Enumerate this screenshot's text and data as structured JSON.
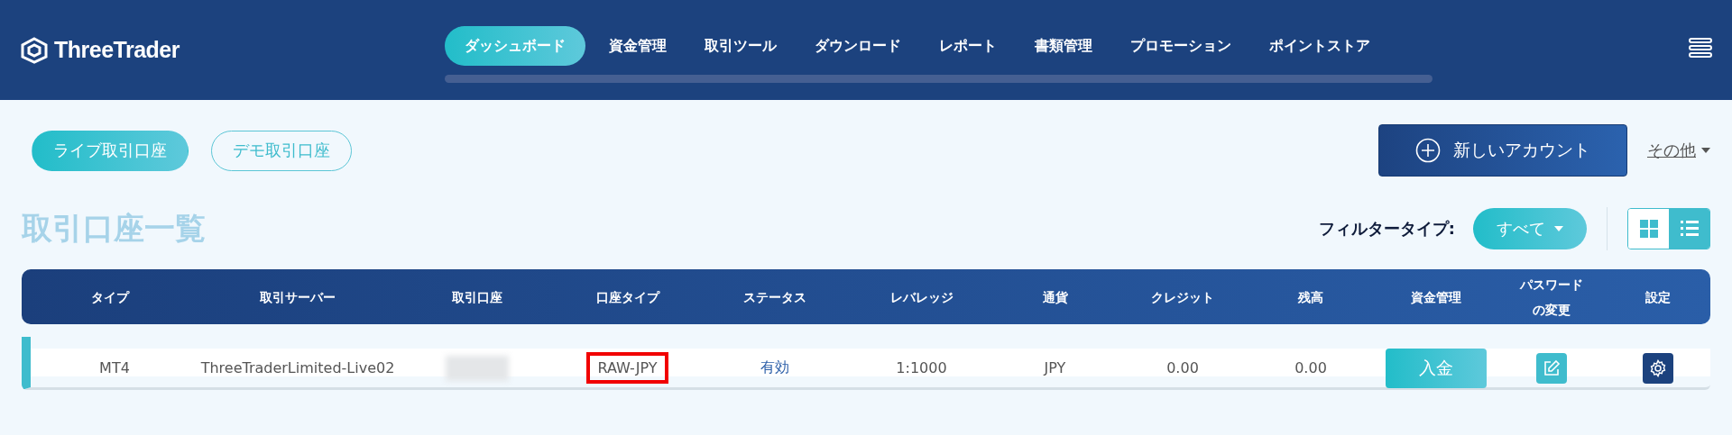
{
  "header": {
    "logo": "ThreeTrader",
    "nav": [
      {
        "label": "ダッシュボード",
        "selected": true
      },
      {
        "label": "資金管理",
        "selected": false
      },
      {
        "label": "取引ツール",
        "selected": false
      },
      {
        "label": "ダウンロード",
        "selected": false
      },
      {
        "label": "レポート",
        "selected": false
      },
      {
        "label": "書類管理",
        "selected": false
      },
      {
        "label": "プロモーション",
        "selected": false
      },
      {
        "label": "ポイントストア",
        "selected": false
      }
    ]
  },
  "account_tabs": [
    {
      "label": "ライブ取引口座",
      "selected": true
    },
    {
      "label": "デモ取引口座",
      "selected": false
    }
  ],
  "new_account_button": "新しいアカウント",
  "more_menu": "その他",
  "title": "取引口座一覧",
  "filter": {
    "label": "フィルタータイプ:",
    "value": "すべて"
  },
  "view_toggle": [
    {
      "kind": "grid",
      "selected": false
    },
    {
      "kind": "list",
      "selected": true
    }
  ],
  "table": {
    "columns": [
      "タイプ",
      "取引サーバー",
      "取引口座",
      "口座タイプ",
      "ステータス",
      "レバレッジ",
      "通貨",
      "クレジット",
      "残高",
      "資金管理",
      "パスワードの変更",
      "設定"
    ],
    "rows": [
      {
        "type": "MT4",
        "server": "ThreeTraderLimited-Live02",
        "account_hidden": true,
        "account_type": "RAW-JPY",
        "account_type_highlighted": true,
        "status": "有効",
        "leverage": "1:1000",
        "currency": "JPY",
        "credit": "0.00",
        "balance": "0.00",
        "deposit_button": "入金"
      }
    ]
  }
}
